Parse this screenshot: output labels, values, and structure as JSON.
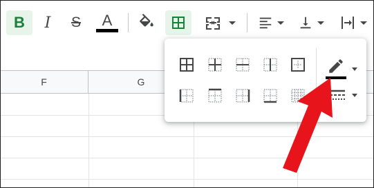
{
  "toolbar": {
    "bold": "B",
    "italic": "I",
    "strikethrough": "S",
    "text_color": "A"
  },
  "columns": [
    "F",
    "G"
  ],
  "colors": {
    "active_bg": "#e6f4ea",
    "active_icon": "#188038",
    "icon": "#444746",
    "arrow": "#e8141b"
  }
}
